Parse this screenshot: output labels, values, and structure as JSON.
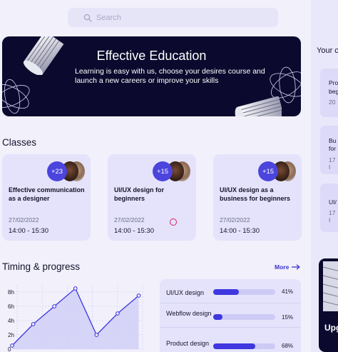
{
  "search": {
    "placeholder": "Search",
    "icon": "search-icon"
  },
  "hero": {
    "title": "Effective Education",
    "description": "Learning is easy with us, choose your desires course and launch a new careers or improve your skills"
  },
  "classes": {
    "title": "Classes",
    "cards": [
      {
        "badge": "+23",
        "title": "Effective communication as a designer",
        "date": "27/02/2022",
        "time": "14:00 - 15:30"
      },
      {
        "badge": "+15",
        "title": "UI/UX design for beginners",
        "date": "27/02/2022",
        "time": "14:00 - 15:30"
      },
      {
        "badge": "+15",
        "title": "UI/UX design as a business for beginners",
        "date": "27/02/2022",
        "time": "14:00 - 15:30"
      }
    ]
  },
  "timing": {
    "title": "Timing & progress",
    "more_label": "More",
    "chart_data": {
      "type": "area",
      "y_ticks": [
        "8h",
        "6h",
        "4h",
        "2h",
        "0"
      ],
      "ylim": [
        0,
        9
      ],
      "values": [
        0.5,
        3.5,
        6,
        8.5,
        2,
        5,
        7.5
      ]
    },
    "progress": [
      {
        "label": "UI/UX design",
        "percent": 41,
        "value_label": "41%"
      },
      {
        "label": "Webflow design",
        "percent": 15,
        "value_label": "15%"
      },
      {
        "label": "Product design",
        "percent": 68,
        "value_label": "68%"
      }
    ]
  },
  "right_panel": {
    "title": "Your c",
    "items": [
      {
        "title_lines": [
          "Pro",
          "beg"
        ],
        "meta": "20"
      },
      {
        "title_lines": [
          "Bu",
          "for"
        ],
        "meta": "17 I"
      },
      {
        "title_lines": [
          "UI/"
        ],
        "meta": "17 I"
      }
    ],
    "upgrade_label": "Upg"
  },
  "colors": {
    "accent": "#4b44dd",
    "dark": "#0b0a2e",
    "card": "#e4e3fb",
    "background": "#f1f0fb"
  }
}
